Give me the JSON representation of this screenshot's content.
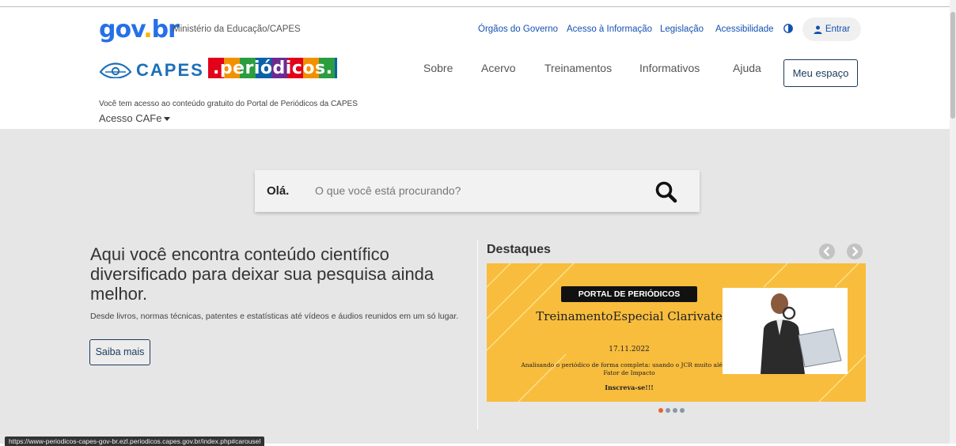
{
  "header": {
    "gov_logo": {
      "g1": "gov",
      "g2": ".",
      "g3": "br"
    },
    "ministry": "Ministério da Educação/CAPES",
    "top_links": [
      "Órgãos do Governo",
      "Acesso à Informação",
      "Legislação",
      "Acessibilidade"
    ],
    "login_label": "Entrar",
    "capes_logo_text": "CAPES",
    "periodicos_logo_text": ".periódicos.",
    "nav": [
      "Sobre",
      "Acervo",
      "Treinamentos",
      "Informativos",
      "Ajuda"
    ],
    "my_space": "Meu espaço",
    "access_message": "Você tem acesso ao conteúdo gratuito do Portal de Periódicos da CAPES",
    "access_menu": "Acesso CAFe"
  },
  "search": {
    "greeting": "Olá.",
    "placeholder": "O que você está procurando?",
    "button_icon": "search-icon"
  },
  "hero": {
    "headline": "Aqui você encontra conteúdo científico diversificado para deixar sua pesquisa ainda melhor.",
    "subline": "Desde livros, normas técnicas, patentes e estatísticas até vídeos e áudios reunidos em um só lugar.",
    "more_button": "Saiba mais"
  },
  "highlights": {
    "title": "Destaques",
    "prev_icon": "chevron-left-icon",
    "next_icon": "chevron-right-icon",
    "slide": {
      "tag": "PORTAL DE PERIÓDICOS",
      "title": "TreinamentoEspecial Clarivate",
      "date": "17.11.2022",
      "description": "Analisando o periódico de forma completa: usando o JCR muito além do Fator de Impacto",
      "cta": "Inscreva-se!!!"
    },
    "slide_count": 4,
    "active_index": 0
  },
  "status_bar_url": "https://www-periodicos-capes-gov-br.ezl.periodicos.capes.gov.br/index.php#carousel",
  "colors": {
    "link_blue": "#1351b4",
    "banner_yellow": "#f8bd3d",
    "main_bg": "#e6e6e6",
    "dot_active": "#e8622c"
  }
}
